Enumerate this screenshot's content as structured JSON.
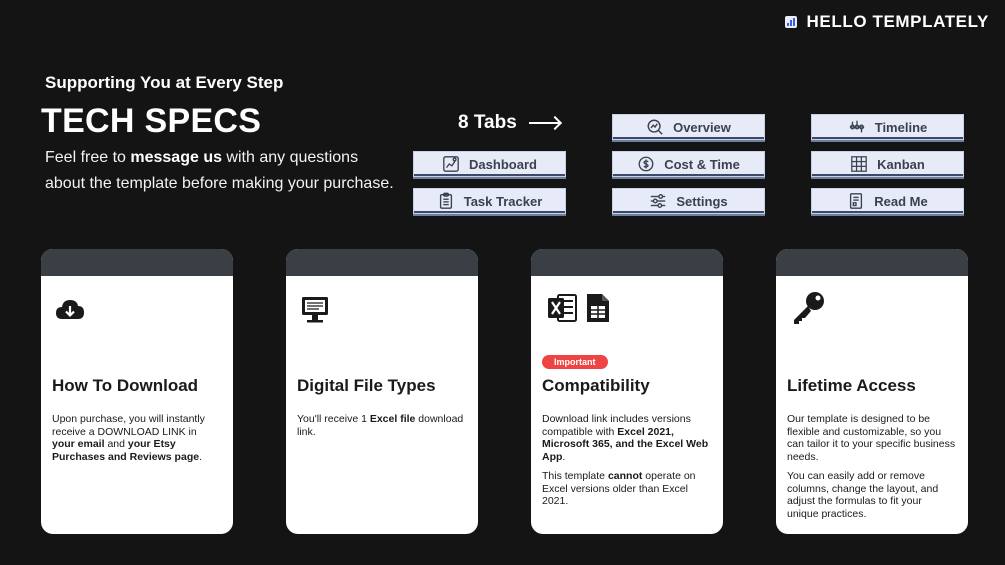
{
  "brand": {
    "name": "HELLO TEMPLATELY",
    "icon": "chart-logo-icon"
  },
  "header": {
    "subtitle": "Supporting You at Every Step",
    "title": "TECH SPECS",
    "intro_pre": "Feel free to ",
    "intro_bold": "message us",
    "intro_post": " with any questions about the template before making your purchase."
  },
  "tabs_section": {
    "label": "8 Tabs",
    "tabs": [
      {
        "label": "Overview",
        "icon": "search-chart-icon"
      },
      {
        "label": "Timeline",
        "icon": "timeline-icon"
      },
      {
        "label": "Dashboard",
        "icon": "dashboard-icon"
      },
      {
        "label": "Cost & Time",
        "icon": "cost-time-icon"
      },
      {
        "label": "Kanban",
        "icon": "kanban-icon"
      },
      {
        "label": "Task Tracker",
        "icon": "clipboard-icon"
      },
      {
        "label": "Settings",
        "icon": "sliders-icon"
      },
      {
        "label": "Read Me",
        "icon": "document-icon"
      }
    ]
  },
  "cards": [
    {
      "title": "How To Download",
      "icon": "cloud-download-icon",
      "p1_a": "Upon purchase, you will instantly receive a DOWNLOAD LINK in ",
      "p1_b": "your email",
      "p1_c": " and ",
      "p1_d": "your Etsy Purchases and Reviews page",
      "p1_e": "."
    },
    {
      "title": "Digital File Types",
      "icon": "computer-icon",
      "p1_a": "You'll receive 1 ",
      "p1_b": "Excel file",
      "p1_c": " download link."
    },
    {
      "title": "Compatibility",
      "icons": [
        "excel-icon",
        "sheets-icon"
      ],
      "badge": "Important",
      "p1_a": "Download link includes versions compatible with ",
      "p1_b": "Excel 2021, Microsoft 365, and the Excel Web App",
      "p1_c": ".",
      "p2_a": "This template ",
      "p2_b": "cannot",
      "p2_c": " operate on Excel versions older than Excel 2021."
    },
    {
      "title": "Lifetime Access",
      "icon": "key-icon",
      "p1": "Our template is designed to be flexible and customizable, so you can tailor it to your specific business needs.",
      "p2": "You can easily add or remove columns, change the layout, and adjust the formulas to fit your unique practices."
    }
  ],
  "colors": {
    "background": "#141414",
    "card": "#ffffff",
    "card_top": "#3a3f45",
    "tab_bg": "#e6ebf7",
    "badge": "#ef4444",
    "brand_logo": "#3b5bdb"
  }
}
